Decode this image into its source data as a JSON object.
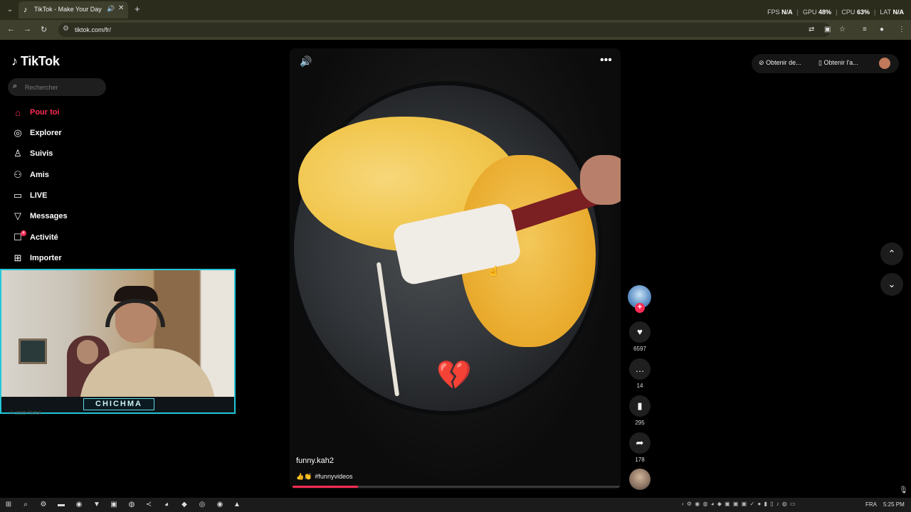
{
  "browser": {
    "tab": {
      "title": "TikTok - Make Your Day",
      "favicon": "tiktok-favicon-icon"
    },
    "url": "tiktok.com/fr/",
    "stats": {
      "fps_label": "FPS",
      "fps_value": "N/A",
      "gpu_label": "GPU",
      "gpu_value": "48%",
      "cpu_label": "CPU",
      "cpu_value": "63%",
      "lat_label": "LAT",
      "lat_value": "N/A"
    }
  },
  "sidebar": {
    "logo": "TikTok",
    "search_placeholder": "Rechercher",
    "items": [
      {
        "label": "Pour toi",
        "icon": "home-icon",
        "active": true
      },
      {
        "label": "Explorer",
        "icon": "compass-icon"
      },
      {
        "label": "Suivis",
        "icon": "following-icon"
      },
      {
        "label": "Amis",
        "icon": "friends-icon"
      },
      {
        "label": "LIVE",
        "icon": "live-icon"
      },
      {
        "label": "Messages",
        "icon": "messages-icon"
      },
      {
        "label": "Activité",
        "icon": "activity-icon",
        "badge": "4"
      },
      {
        "label": "Importer",
        "icon": "upload-icon"
      }
    ],
    "copyright": "© 2025 TikTok"
  },
  "webcam": {
    "caption": "CHICHMA"
  },
  "video": {
    "author": "funny.kah2",
    "description_emoji": "👍👏",
    "hashtag": "#funnyvideos",
    "progress_percent": 20
  },
  "actions": {
    "likes": "6597",
    "comments": "14",
    "saves": "295",
    "shares": "178"
  },
  "topright": {
    "coins_label": "Obtenir de...",
    "app_label": "Obtenir l'a..."
  },
  "taskbar": {
    "language": "FRA",
    "time": "5:25 PM"
  }
}
